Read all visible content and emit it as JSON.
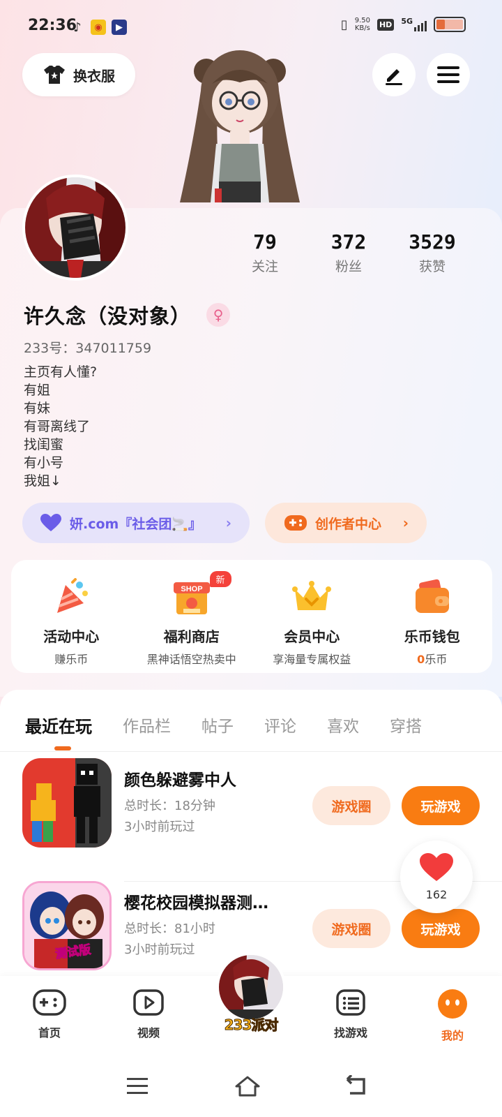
{
  "status_bar": {
    "time": "22:36",
    "net_speed_value": "9.50",
    "net_speed_unit": "KB/s",
    "hd_badge": "HD",
    "network": "5G"
  },
  "header": {
    "outfit_label": "换衣服",
    "edit_icon": "pen-icon",
    "menu_icon": "hamburger-menu-icon"
  },
  "profile": {
    "stats": [
      {
        "value": "79",
        "label": "关注"
      },
      {
        "value": "372",
        "label": "粉丝"
      },
      {
        "value": "3529",
        "label": "获赞"
      }
    ],
    "nickname": "许久念（没对象）",
    "gender_symbol": "♀",
    "uid": "233号：347011759",
    "bio": [
      "主页有人懂?",
      "有姐",
      "有妹",
      "有哥离线了",
      "找闺蜜",
      "有小号",
      "我姐↓"
    ],
    "group_pill": "妍.com『社会团🚬』",
    "creator_pill": "创作者中心"
  },
  "features": [
    {
      "title": "活动中心",
      "sub": "赚乐币",
      "icon": "party-popper-icon"
    },
    {
      "title": "福利商店",
      "sub": "黑神话悟空热卖中",
      "icon": "shop-icon",
      "badge": "新"
    },
    {
      "title": "会员中心",
      "sub": "享海量专属权益",
      "icon": "crown-icon"
    },
    {
      "title": "乐币钱包",
      "sub_value": "0",
      "sub": "乐币",
      "icon": "wallet-icon"
    }
  ],
  "tabs": [
    "最近在玩",
    "作品栏",
    "帖子",
    "评论",
    "喜欢",
    "穿搭"
  ],
  "active_tab": "最近在玩",
  "games": [
    {
      "title": "颜色躲避雾中人",
      "duration": "总时长：18分钟",
      "last_played": "3小时前玩过",
      "circle_btn": "游戏圈",
      "play_btn": "玩游戏"
    },
    {
      "title": "樱花校园模拟器测…",
      "duration": "总时长：81小时",
      "last_played": "3小时前玩过",
      "circle_btn": "游戏圈",
      "play_btn": "玩游戏",
      "icon_overlay": "测试版"
    }
  ],
  "like_float": {
    "count": "162"
  },
  "bottom_nav": [
    {
      "label": "首页",
      "icon": "gamepad-icon"
    },
    {
      "label": "视频",
      "icon": "video-play-icon"
    },
    {
      "label": "233派对",
      "icon": "avatar"
    },
    {
      "label": "找游戏",
      "icon": "list-icon"
    },
    {
      "label": "我的",
      "icon": "smile-face-icon"
    }
  ],
  "colors": {
    "accent": "#f97c12",
    "purple": "#6a5ce8"
  }
}
